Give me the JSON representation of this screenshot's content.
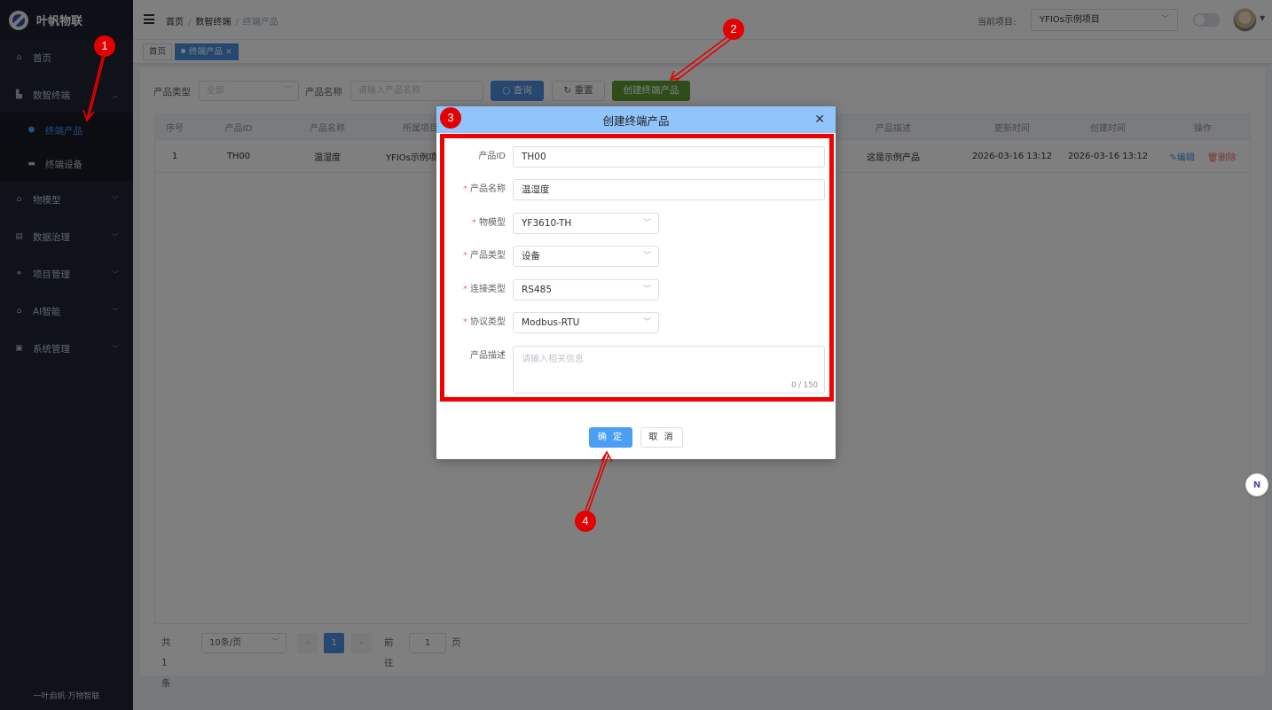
{
  "sidebar": {
    "logo_text": "叶帆物联",
    "items": [
      {
        "label": "首页",
        "icon": "home-icon"
      },
      {
        "label": "数智终端",
        "icon": "chart-icon"
      },
      {
        "label": "物模型",
        "icon": "bank-icon"
      },
      {
        "label": "数据治理",
        "icon": "document-icon"
      },
      {
        "label": "项目管理",
        "icon": "project-icon"
      },
      {
        "label": "AI智能",
        "icon": "bank-icon"
      },
      {
        "label": "系统管理",
        "icon": "monitor-icon"
      }
    ],
    "sub_items": [
      {
        "label": "终端产品",
        "icon": "cube-icon",
        "active": true
      },
      {
        "label": "终端设备",
        "icon": "device-icon",
        "active": false
      }
    ],
    "footer": "一叶启帆·万物智联"
  },
  "header": {
    "breadcrumb": [
      "首页",
      "数智终端",
      "终端产品"
    ],
    "project_label": "当前项目:",
    "project_value": "YFIOs示例项目"
  },
  "tags": [
    {
      "label": "首页",
      "active": false
    },
    {
      "label": "终端产品",
      "active": true
    }
  ],
  "filter": {
    "type_label": "产品类型",
    "type_value": "全部",
    "name_label": "产品名称",
    "name_placeholder": "请输入产品名称",
    "search_btn": "查询",
    "reset_btn": "重置",
    "create_btn": "创建终端产品"
  },
  "table": {
    "columns": [
      "序号",
      "产品ID",
      "产品名称",
      "所属项目",
      "产品描述",
      "更新时间",
      "创建时间",
      "操作"
    ],
    "rows": [
      {
        "index": "1",
        "id": "TH00",
        "name": "温湿度",
        "project": "YFIOs示例项目",
        "desc": "这是示例产品",
        "updated": "2026-03-16 13:12",
        "created": "2026-03-16 13:12"
      }
    ],
    "edit_label": "编辑",
    "delete_label": "删除"
  },
  "pagination": {
    "total": "共 1 条",
    "page_size": "10条/页",
    "current_page": "1",
    "goto_label": "前往",
    "goto_value": "1",
    "page_suffix": "页"
  },
  "dialog": {
    "title": "创建终端产品",
    "fields": [
      {
        "label": "产品ID",
        "required": false,
        "value": "TH00"
      },
      {
        "label": "产品名称",
        "required": true,
        "value": "温湿度"
      },
      {
        "label": "物模型",
        "required": true,
        "value": "YF3610-TH"
      },
      {
        "label": "产品类型",
        "required": true,
        "value": "设备"
      },
      {
        "label": "连接类型",
        "required": true,
        "value": "RS485"
      },
      {
        "label": "协议类型",
        "required": true,
        "value": "Modbus-RTU"
      }
    ],
    "desc_label": "产品描述",
    "desc_placeholder": "请输入相关信息",
    "desc_count": "0 / 150",
    "ok_btn": "确 定",
    "cancel_btn": "取 消"
  },
  "annotations": [
    "1",
    "2",
    "3",
    "4"
  ],
  "colors": {
    "sidebar": "#1f2533",
    "primary": "#4a8ee0",
    "success": "#5d9b33",
    "annotation": "#e30000",
    "dialog_header": "#91c4fb"
  }
}
